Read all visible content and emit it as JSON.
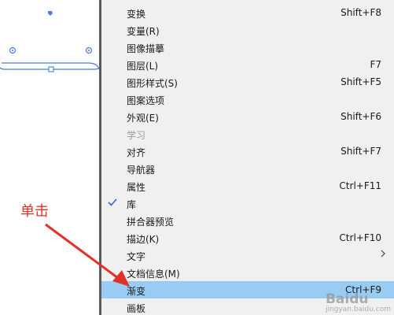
{
  "menu": {
    "items": [
      {
        "label": "变换",
        "shortcut": "Shift+F8"
      },
      {
        "label": "变量(R)",
        "shortcut": ""
      },
      {
        "label": "图像描摹",
        "shortcut": ""
      },
      {
        "label": "图层(L)",
        "shortcut": "F7"
      },
      {
        "label": "图形样式(S)",
        "shortcut": "Shift+F5"
      },
      {
        "label": "图案选项",
        "shortcut": ""
      },
      {
        "label": "外观(E)",
        "shortcut": "Shift+F6"
      },
      {
        "label": "学习",
        "shortcut": ""
      },
      {
        "label": "对齐",
        "shortcut": "Shift+F7"
      },
      {
        "label": "导航器",
        "shortcut": ""
      },
      {
        "label": "属性",
        "shortcut": "Ctrl+F11"
      },
      {
        "label": "库",
        "shortcut": ""
      },
      {
        "label": "拼合器预览",
        "shortcut": ""
      },
      {
        "label": "描边(K)",
        "shortcut": "Ctrl+F10"
      },
      {
        "label": "文字",
        "shortcut": ""
      },
      {
        "label": "文档信息(M)",
        "shortcut": ""
      },
      {
        "label": "渐变",
        "shortcut": "Ctrl+F9"
      },
      {
        "label": "画板",
        "shortcut": ""
      }
    ]
  },
  "annotation": {
    "text": "单击"
  },
  "watermark": {
    "text": "Baidu",
    "subtext": "jingyan.baidu.com"
  },
  "colors": {
    "highlight": "#99ccf3",
    "annotation": "#e0312b",
    "selection": "#4a7fd6"
  }
}
